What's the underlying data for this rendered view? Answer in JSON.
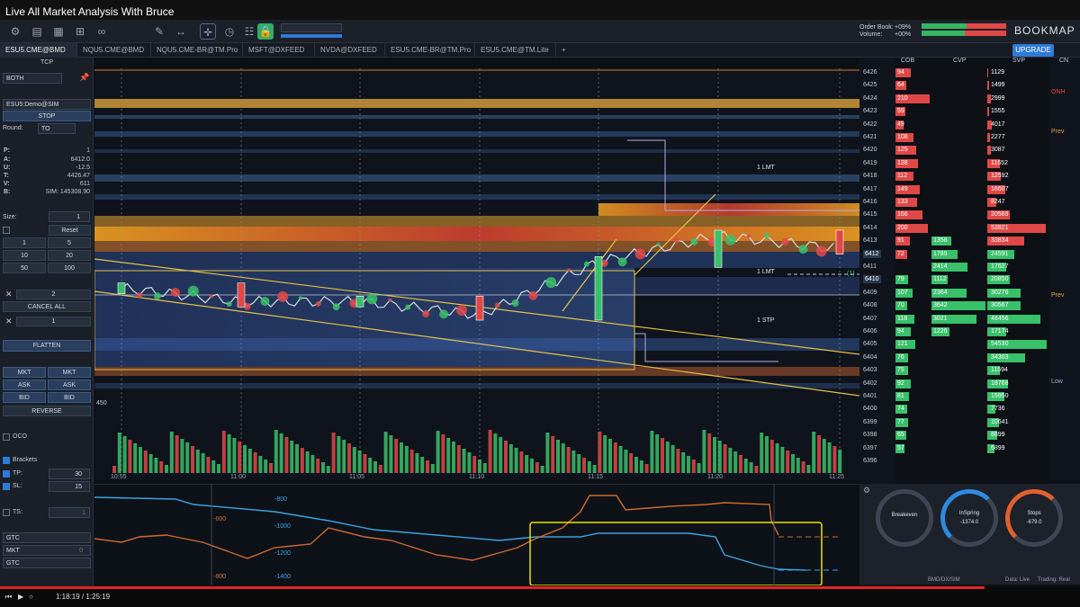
{
  "video": {
    "title": "Live All Market Analysis With Bruce",
    "time": "1:18:19 / 1:25:19"
  },
  "toolbar": {
    "orderbook_label": "Order Book:",
    "orderbook_value": "+09%",
    "volume_label": "Volume:",
    "volume_value": "+00%",
    "brand": "BOOKMAP",
    "upgrade": "UPGRADE"
  },
  "tabs": [
    "ESU5.CME@BMD",
    "NQU5.CME@BMD",
    "NQU5.CME-BR@TM.Pro",
    "MSFT@DXFEED",
    "NVDA@DXFEED",
    "ESU5.CME-BR@TM.Pro",
    "ESU5.CME@TM.Lite"
  ],
  "left": {
    "section": "TCP",
    "side": "BOTH",
    "account": "ESU5:Demo@SIM",
    "stop": "STOP",
    "round_label": "Round:",
    "round_value": "TO",
    "stats": [
      {
        "k": "P:",
        "v": "1"
      },
      {
        "k": "A:",
        "v": "6412.0"
      },
      {
        "k": "U:",
        "v": "-12.5"
      },
      {
        "k": "T:",
        "v": "4426.47"
      },
      {
        "k": "V:",
        "v": "611"
      },
      {
        "k": "B:",
        "v": "SIM: 145308.90"
      }
    ],
    "size_label": "Size:",
    "size_value": "1",
    "reset": "Reset",
    "qty": [
      "1",
      "5",
      "10",
      "20",
      "50",
      "100"
    ],
    "cancel_count": "2",
    "cancel_all": "CANCEL ALL",
    "pos_count": "1",
    "flatten": "FLATTEN",
    "order_btns": [
      "MKT",
      "MKT",
      "ASK",
      "ASK",
      "BID",
      "BID"
    ],
    "reverse": "REVERSE",
    "oco": "OCO",
    "brackets": "Brackets",
    "tp_label": "TP:",
    "tp_value": "30",
    "sl_label": "SL:",
    "sl_value": "15",
    "ts_label": "TS:",
    "ts_value": "1",
    "gtc1": "GTC",
    "mkt": "MKT",
    "mkt_value": "0",
    "gtc2": "GTC"
  },
  "chart": {
    "times": [
      "10:55",
      "11:00",
      "11:05",
      "11:10",
      "11:15",
      "11:20",
      "11:25"
    ],
    "orders": [
      "1 LMT",
      "1 LMT",
      "1 STP"
    ],
    "pos_marker": "(1)",
    "vol_label": "450",
    "lower_labels": [
      "-800",
      "-600",
      "-1000",
      "-1200",
      "-800",
      "-1400"
    ]
  },
  "ladder": {
    "headers": [
      "COB",
      "CVP",
      "SVP",
      "CN"
    ],
    "prices": [
      "6426",
      "6425",
      "6424",
      "6423",
      "6422",
      "6421",
      "6420",
      "6419",
      "6418",
      "6417",
      "6416",
      "6415",
      "6414",
      "6413",
      "6412",
      "6411",
      "6410",
      "6409",
      "6408",
      "6407",
      "6406",
      "6405",
      "6404",
      "6403",
      "6402",
      "6401",
      "6400",
      "6399",
      "6398",
      "6397",
      "6396"
    ],
    "cob": [
      "94",
      "64",
      "210",
      "59",
      "49",
      "108",
      "125",
      "138",
      "112",
      "149",
      "133",
      "166",
      "200",
      "91",
      "72",
      "",
      "79",
      "107",
      "70",
      "118",
      "94",
      "121",
      "76",
      "75",
      "92",
      "81",
      "74",
      "77",
      "65",
      "57",
      ""
    ],
    "cvp": [
      "",
      "",
      "",
      "",
      "",
      "",
      "",
      "",
      "",
      "",
      "",
      "",
      "",
      "1358",
      "1789",
      "2414",
      "1112",
      "2364",
      "3642",
      "3021",
      "1226",
      "",
      "",
      "",
      "",
      "",
      "",
      "",
      "",
      "",
      ""
    ],
    "svp": [
      "1129",
      "1499",
      "2999",
      "1555",
      "4017",
      "2277",
      "3087",
      "11652",
      "12592",
      "16607",
      "8247",
      "20569",
      "53821",
      "33834",
      "24591",
      "17627",
      "20850",
      "30276",
      "30567",
      "48456",
      "17174",
      "54530",
      "34303",
      "11594",
      "18768",
      "15950",
      "7736",
      "10641",
      "8899",
      "6899",
      ""
    ],
    "right_labels": [
      "ONH",
      "Prev",
      "Prev",
      "Low"
    ]
  },
  "gauges": [
    {
      "label": "Breakeven",
      "value": ""
    },
    {
      "label": "InSpring",
      "value": "-1374.0"
    },
    {
      "label": "Stops",
      "value": "-679.0"
    }
  ],
  "footer": {
    "account": "BMD/DX/SIM",
    "data": "Data: Live",
    "trading": "Trading: Real"
  },
  "colors": {
    "bid": "#e04848",
    "ask": "#39c06a",
    "accent": "#2f7ad6",
    "box": "#f0e000"
  },
  "chart_data": {
    "type": "candlestick",
    "title": "",
    "xlabel": "",
    "ylabel": "",
    "ylim": [
      6396,
      6426
    ],
    "x": [
      "10:55",
      "11:00",
      "11:05",
      "11:10",
      "11:15",
      "11:20",
      "11:25"
    ],
    "series": [
      {
        "values": [
          6410,
          6409,
          6409,
          6408,
          6412,
          6414,
          6413
        ]
      }
    ],
    "grid": true
  }
}
